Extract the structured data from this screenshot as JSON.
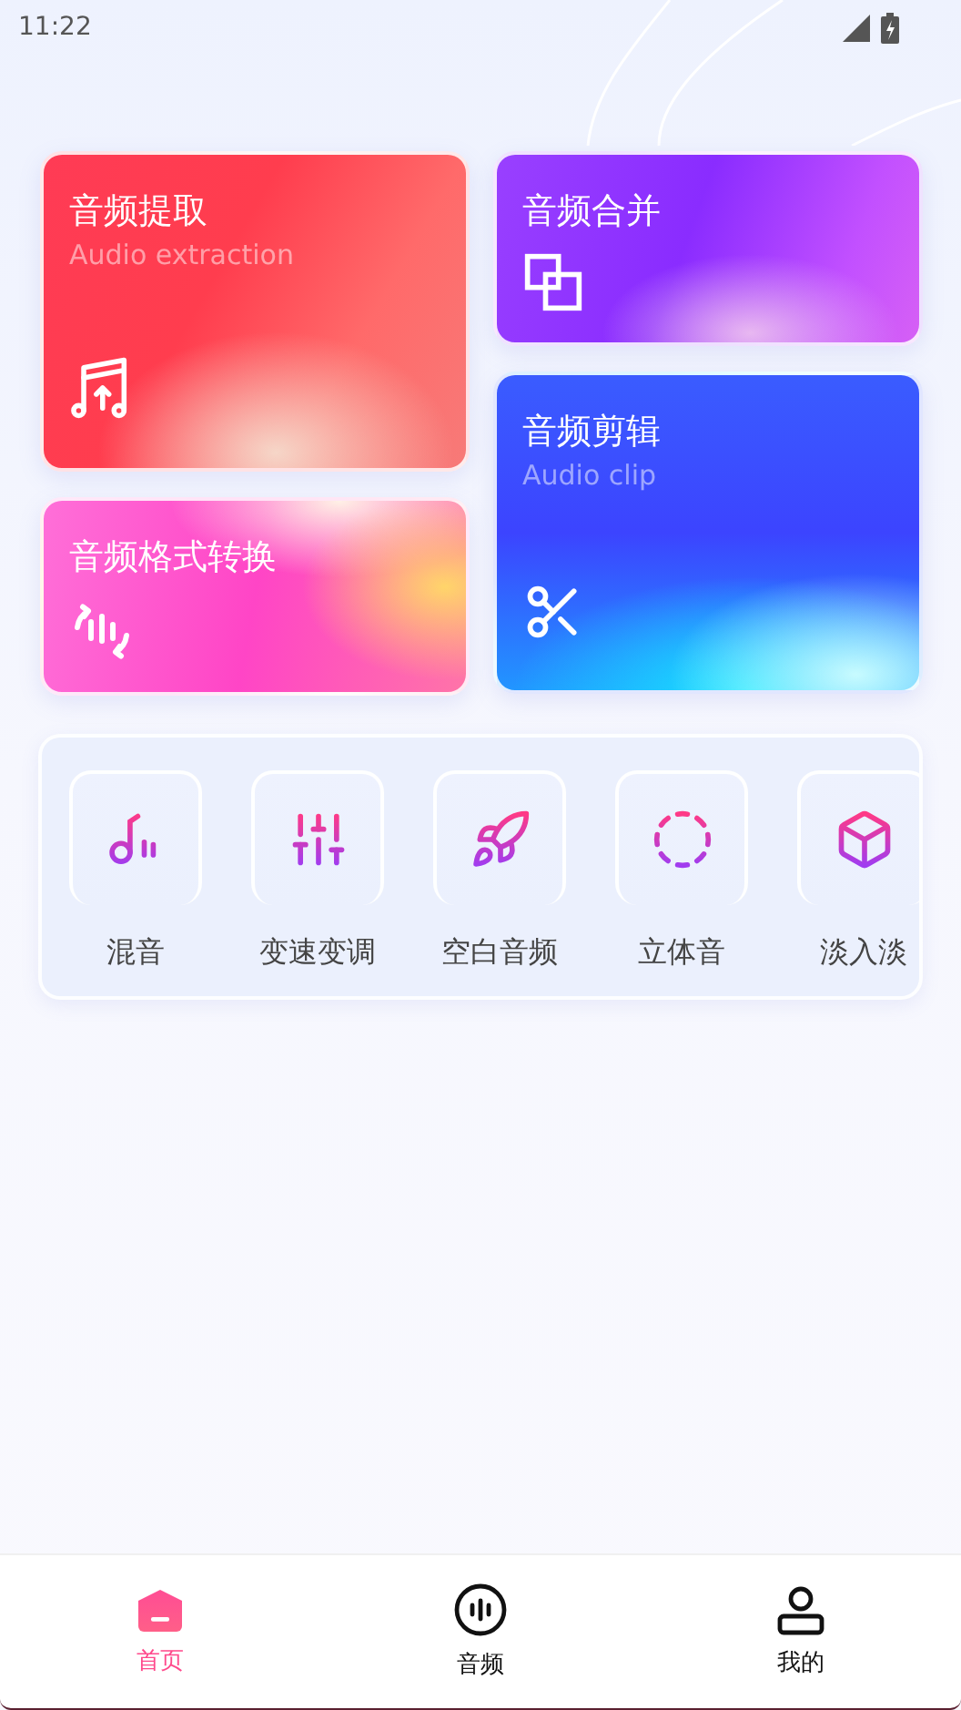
{
  "status_bar": {
    "time": "11:22"
  },
  "feature_cards": [
    {
      "title": "音频提取",
      "subtitle": "Audio extraction"
    },
    {
      "title": "音频格式转换"
    },
    {
      "title": "音频合并"
    },
    {
      "title": "音频剪辑",
      "subtitle": "Audio clip"
    }
  ],
  "tools": [
    {
      "label": "混音"
    },
    {
      "label": "变速变调"
    },
    {
      "label": "空白音频"
    },
    {
      "label": "立体音"
    },
    {
      "label": "淡入淡"
    }
  ],
  "bottom_nav": [
    {
      "label": "首页",
      "selected": true
    },
    {
      "label": "音频",
      "selected": false
    },
    {
      "label": "我的",
      "selected": false
    }
  ]
}
